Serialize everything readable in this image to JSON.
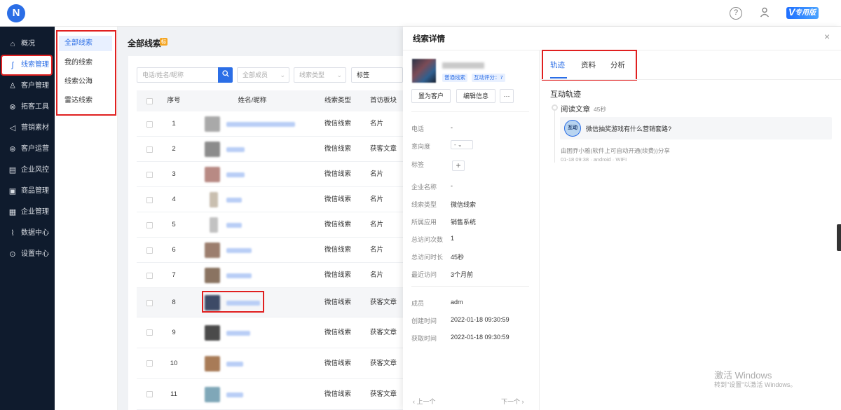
{
  "topbar": {
    "logo": "N",
    "edition": "专用版"
  },
  "sidebar": {
    "items": [
      {
        "label": "概况",
        "icon": "home-icon"
      },
      {
        "label": "线索管理",
        "icon": "route-icon"
      },
      {
        "label": "客户管理",
        "icon": "users-icon"
      },
      {
        "label": "拓客工具",
        "icon": "toolbox-icon"
      },
      {
        "label": "营销素材",
        "icon": "megaphone-icon"
      },
      {
        "label": "客户运营",
        "icon": "operation-icon"
      },
      {
        "label": "企业风控",
        "icon": "shield-icon"
      },
      {
        "label": "商品管理",
        "icon": "goods-icon"
      },
      {
        "label": "企业管理",
        "icon": "briefcase-icon"
      },
      {
        "label": "数据中心",
        "icon": "chart-icon"
      },
      {
        "label": "设置中心",
        "icon": "settings-icon"
      }
    ]
  },
  "submenu": {
    "items": [
      "全部线索",
      "我的线索",
      "线索公海",
      "雷达线索"
    ]
  },
  "main": {
    "title": "全部线索",
    "title_tag": "标",
    "filters": {
      "search_placeholder": "电话/姓名/昵称",
      "member_placeholder": "全部成员",
      "type_placeholder": "线索类型",
      "tag_label": "标签"
    },
    "columns": [
      "序号",
      "姓名/昵称",
      "线索类型",
      "首访板块"
    ],
    "rows": [
      {
        "num": "1",
        "type": "微信线索",
        "board": "名片"
      },
      {
        "num": "2",
        "type": "微信线索",
        "board": "获客文章"
      },
      {
        "num": "3",
        "type": "微信线索",
        "board": "名片"
      },
      {
        "num": "4",
        "type": "微信线索",
        "board": "名片"
      },
      {
        "num": "5",
        "type": "微信线索",
        "board": "名片"
      },
      {
        "num": "6",
        "type": "微信线索",
        "board": "名片"
      },
      {
        "num": "7",
        "type": "微信线索",
        "board": "名片"
      },
      {
        "num": "8",
        "type": "微信线索",
        "board": "获客文章"
      },
      {
        "num": "9",
        "type": "微信线索",
        "board": "获客文章"
      },
      {
        "num": "10",
        "type": "微信线索",
        "board": "获客文章"
      },
      {
        "num": "11",
        "type": "微信线索",
        "board": "获客文章"
      }
    ]
  },
  "drawer": {
    "title": "线索详情",
    "profile_tags": [
      "普通线索",
      "互动评分：7"
    ],
    "buttons": [
      "置为客户",
      "编辑信息",
      "···"
    ],
    "fields": [
      {
        "label": "电话",
        "value": "-"
      },
      {
        "label": "意向度",
        "value": "-"
      },
      {
        "label": "标签",
        "value": "+"
      },
      {
        "label": "企业名称",
        "value": "-"
      },
      {
        "label": "线索类型",
        "value": "微信线索"
      },
      {
        "label": "所属应用",
        "value": "销售系统"
      },
      {
        "label": "总访问次数",
        "value": "1"
      },
      {
        "label": "总访问时长",
        "value": "45秒"
      },
      {
        "label": "最近访问",
        "value": "3个月前"
      },
      {
        "label": "成员",
        "value": "adm"
      },
      {
        "label": "创建时间",
        "value": "2022-01-18 09:30:59"
      },
      {
        "label": "获取时间",
        "value": "2022-01-18 09:30:59"
      }
    ],
    "prev": "上一个",
    "next": "下一个",
    "tabs": [
      "轨迹",
      "资料",
      "分析"
    ],
    "section_title": "互动轨迹",
    "event": {
      "title": "阅读文章",
      "duration": "45秒",
      "card_icon_text": "互动",
      "card_text": "微信抽奖游戏有什么营销套路?",
      "source": "由困乔小雅(软件上可自动开通(续费))分享",
      "meta": "01-18 09:38 · android · WIFI"
    }
  },
  "watermark": {
    "line1": "激活 Windows",
    "line2": "转到\"设置\"以激活 Windows。"
  }
}
